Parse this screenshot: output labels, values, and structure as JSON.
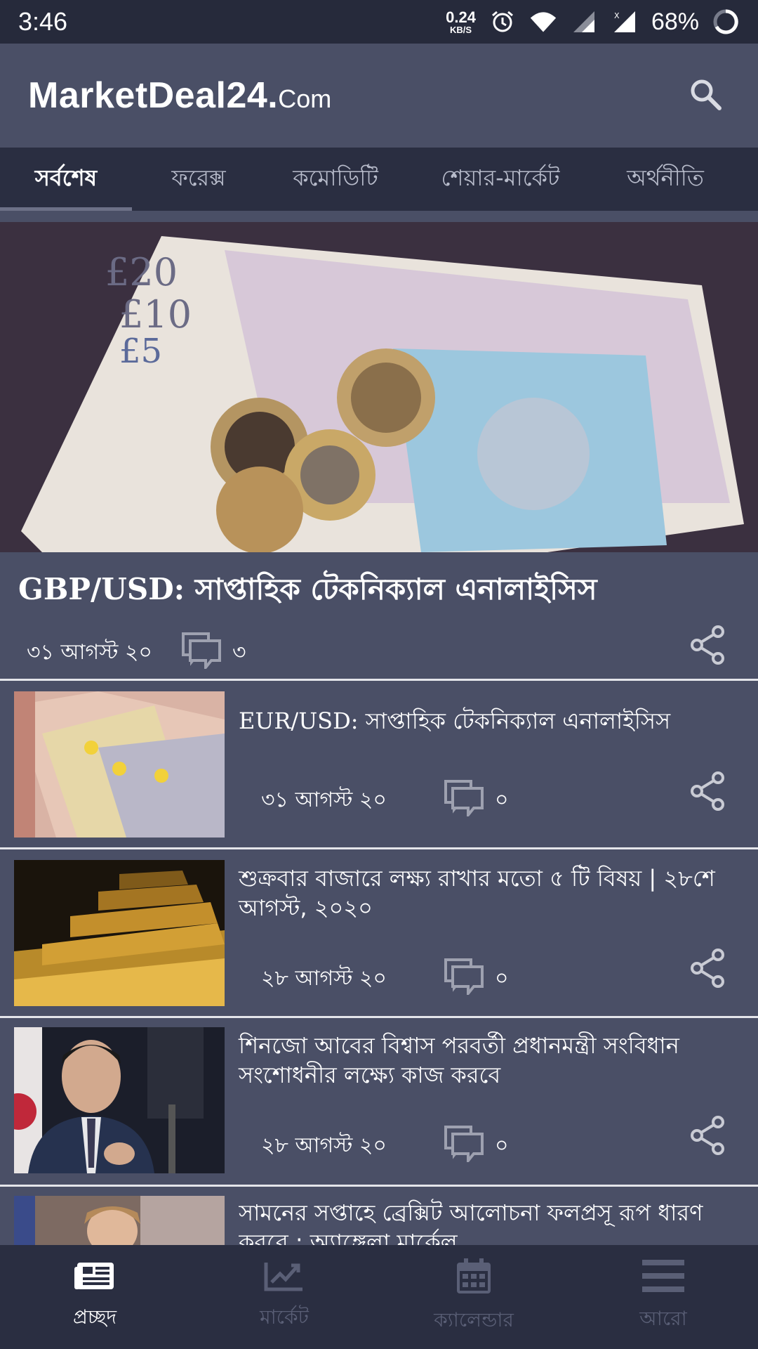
{
  "status_bar": {
    "time": "3:46",
    "net_speed_value": "0.24",
    "net_speed_unit": "KB/S",
    "battery": "68%"
  },
  "app_bar": {
    "logo_main": "MarketDeal24.",
    "logo_suffix": "Com"
  },
  "tabs": [
    {
      "label": "সর্বশেষ",
      "active": true
    },
    {
      "label": "ফরেক্স",
      "active": false
    },
    {
      "label": "কমোডিটি",
      "active": false
    },
    {
      "label": "শেয়ার-মার্কেট",
      "active": false
    },
    {
      "label": "অর্থনীতি",
      "active": false
    }
  ],
  "featured": {
    "title": "GBP/USD: সাপ্তাহিক টেকনিক্যাল এনালাইসিস",
    "date": "৩১ আগস্ট ২০",
    "comments": "৩"
  },
  "articles": [
    {
      "title": "EUR/USD: সাপ্তাহিক টেকনিক্যাল এনালাইসিস",
      "date": "৩১ আগস্ট ২০",
      "comments": "০"
    },
    {
      "title": "শুক্রবার বাজারে লক্ষ্য রাখার মতো ৫ টি বিষয় | ২৮শে আগস্ট, ২০২০",
      "date": "২৮ আগস্ট ২০",
      "comments": "০"
    },
    {
      "title": "শিনজো আবের বিশ্বাস পরবর্তী প্রধানমন্ত্রী সংবিধান সংশোধনীর লক্ষ্যে কাজ করবে",
      "date": "২৮ আগস্ট ২০",
      "comments": "০"
    },
    {
      "title": "সামনের সপ্তাহে ব্রেক্সিট আলোচনা ফলপ্রসূ রূপ ধারণ করবে : অ্যাঙ্গেলা মার্কেল"
    }
  ],
  "bottom_nav": [
    {
      "label": "প্রচ্ছদ",
      "icon": "newspaper-icon",
      "active": true
    },
    {
      "label": "মার্কেট",
      "icon": "trending-up-icon",
      "active": false
    },
    {
      "label": "ক্যালেন্ডার",
      "icon": "calendar-icon",
      "active": false
    },
    {
      "label": "আরো",
      "icon": "menu-icon",
      "active": false
    }
  ],
  "colors": {
    "background": "#4a4f66",
    "status_bar": "#262a3b",
    "tab_bar": "#2a2e41",
    "divider": "#e4e5ea",
    "inactive_nav": "#5a5f76"
  }
}
